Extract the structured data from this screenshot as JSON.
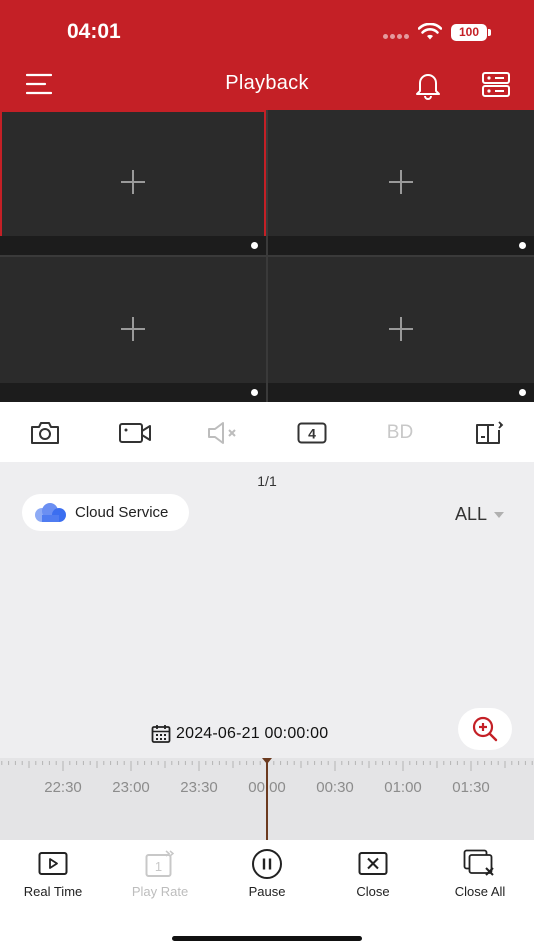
{
  "status_bar": {
    "time": "04:01",
    "battery": "100"
  },
  "header": {
    "title": "Playback"
  },
  "page_indicator": "1/1",
  "cloud_service": {
    "label": "Cloud Service"
  },
  "filter": {
    "selected": "ALL"
  },
  "toolbar": {
    "bd_label": "BD",
    "window_count": "4"
  },
  "date": "2024-06-21 00:00:00",
  "timeline": {
    "labels": [
      "22:30",
      "23:00",
      "23:30",
      "00:00",
      "00:30",
      "01:00",
      "01:30"
    ]
  },
  "bottom_bar": {
    "real_time": "Real Time",
    "play_rate": "Play Rate",
    "play_rate_value": "1",
    "pause": "Pause",
    "close": "Close",
    "close_all": "Close All"
  },
  "colors": {
    "brand": "#c42026",
    "cursor": "#6b3a1f",
    "cloud": "#3b6ef0"
  }
}
